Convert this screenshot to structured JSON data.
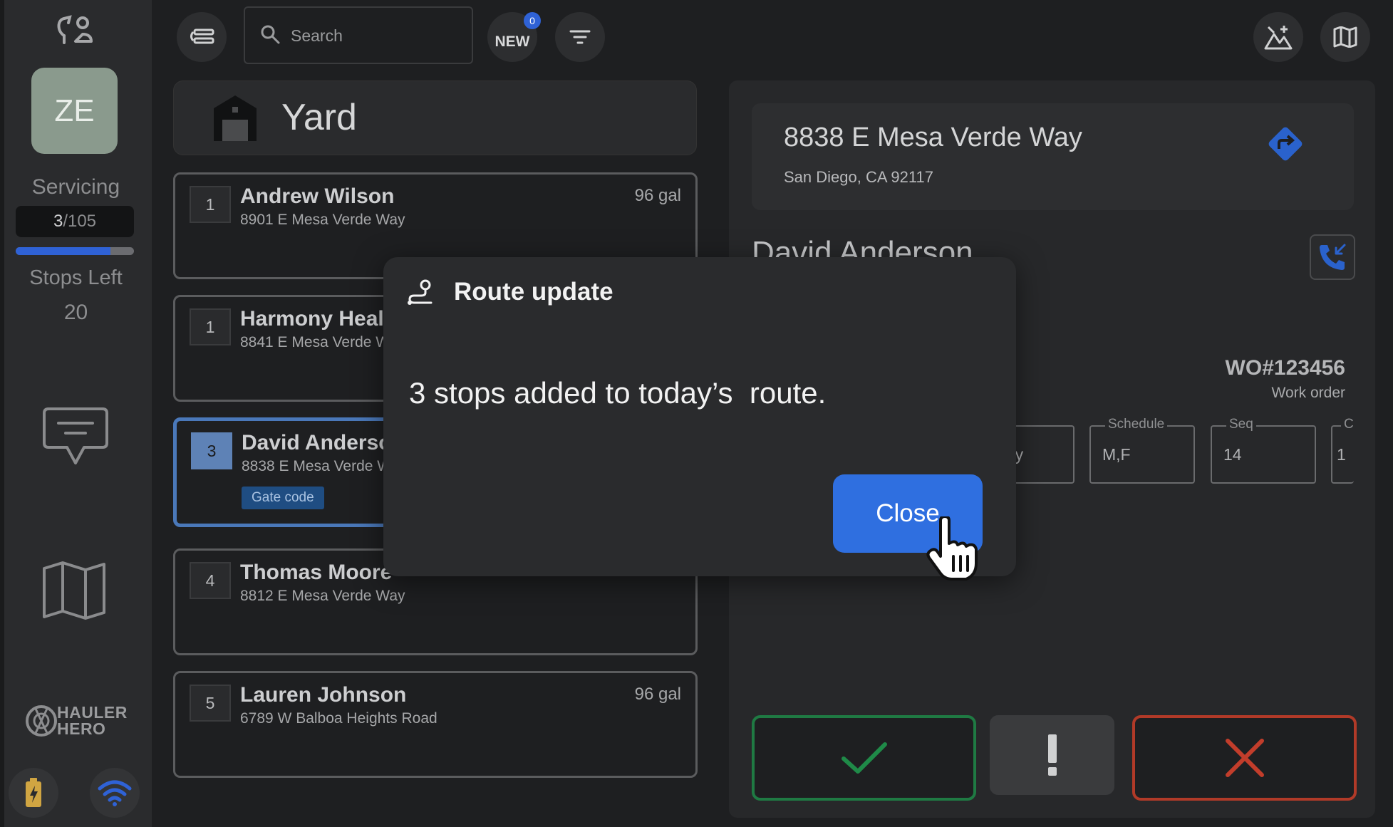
{
  "sidebar": {
    "avatar_initials": "ZE",
    "servicing_label": "Servicing",
    "served_count": "3",
    "total_count": "/105",
    "progress_fraction": 0.8,
    "stops_left_label": "Stops Left",
    "stops_left_value": "20",
    "brand_line1": "HAULER",
    "brand_line2": "HERO",
    "icons": [
      "route-icon",
      "chat-icon",
      "map-icon",
      "battery-icon",
      "wifi-icon"
    ]
  },
  "topbar": {
    "search_placeholder": "Search",
    "new_label": "NEW",
    "new_count": "0",
    "icons": [
      "list-toggle-icon",
      "search-icon",
      "filter-icon",
      "add-photo-icon",
      "map-icon"
    ]
  },
  "yard": {
    "label": "Yard"
  },
  "stops": [
    {
      "seq": "1",
      "name": "Andrew Wilson",
      "address": "8901 E Mesa Verde Way",
      "volume": "96 gal"
    },
    {
      "seq": "1",
      "name": "Harmony Heal",
      "address": "8841 E Mesa Verde W",
      "volume": ""
    },
    {
      "seq": "3",
      "name": "David Anderso",
      "address": "8838 E Mesa Verde W",
      "volume": "",
      "tag": "Gate code",
      "selected": true
    },
    {
      "seq": "4",
      "name": "Thomas Moore",
      "address": "8812 E Mesa Verde Way",
      "volume": ""
    },
    {
      "seq": "5",
      "name": "Lauren Johnson",
      "address": "6789 W Balboa Heights Road",
      "volume": "96 gal"
    }
  ],
  "detail": {
    "address_line1": "8838 E Mesa Verde Way",
    "address_line2": "San Diego, CA 92117",
    "customer_name": "David Anderson",
    "work_order_number": "WO#123456",
    "work_order_label": "Work order",
    "fields": [
      {
        "label": "",
        "value": "kly"
      },
      {
        "label": "Schedule",
        "value": "M,F"
      },
      {
        "label": "Seq",
        "value": "14"
      },
      {
        "label": "C",
        "value": "1"
      }
    ],
    "action_colors": {
      "complete": "#1f7a43",
      "issue": "#3a3b3d",
      "skip": "#b13a28"
    }
  },
  "modal": {
    "title": "Route update",
    "message": "3 stops added to today’s  route.",
    "close_label": "Close"
  },
  "colors": {
    "accent": "#2f6fe0",
    "background": "#1e1f21",
    "panel": "#2a2b2d"
  }
}
